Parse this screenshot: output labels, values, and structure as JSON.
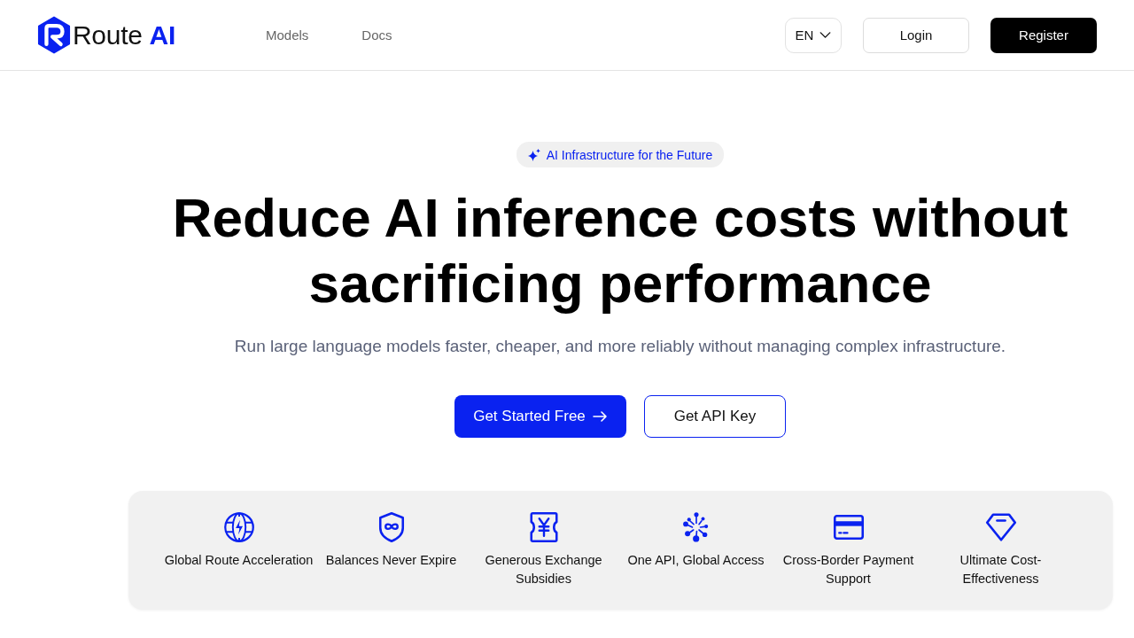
{
  "header": {
    "logo": "Route **AI**",
    "nav": [
      {
        "label": "Models"
      },
      {
        "label": "Docs"
      }
    ],
    "language": "EN",
    "login": "Login",
    "register": "Register"
  },
  "hero": {
    "badge": "AI Infrastructure for the Future",
    "headline_lines": [
      "Reduce AI inference costs without",
      "sacrificing performance"
    ],
    "subtitle": "Run large language models faster, cheaper, and more reliably without managing complex infrastructure.",
    "primary_button": "Get Started Free",
    "secondary_button": "Get API Key"
  },
  "features": [
    {
      "kind": "globe",
      "label": "Global Route Acceleration"
    },
    {
      "kind": "shield",
      "label": "Balances Never Expire"
    },
    {
      "kind": "ticket",
      "label": "Generous Exchange Subsidies"
    },
    {
      "kind": "hub",
      "label": "One API, Global Access"
    },
    {
      "kind": "card",
      "label": "Cross-Border Payment Support"
    },
    {
      "kind": "diamond",
      "label": "Ultimate Cost-Effectiveness"
    }
  ]
}
